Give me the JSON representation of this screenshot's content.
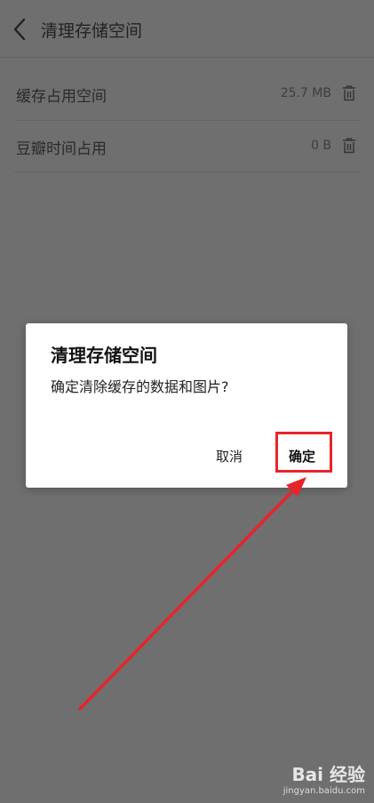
{
  "header": {
    "title": "清理存储空间"
  },
  "storage_rows": [
    {
      "label": "缓存占用空间",
      "value": "25.7 MB"
    },
    {
      "label": "豆瓣时间占用",
      "value": "0 B"
    }
  ],
  "dialog": {
    "title": "清理存储空间",
    "message": "确定清除缓存的数据和图片?",
    "cancel_label": "取消",
    "confirm_label": "确定"
  },
  "watermark": {
    "logo": "Bai 经验",
    "url": "jingyan.baidu.com"
  },
  "colors": {
    "overlay": "#6f6f6f",
    "annotation": "#e8242b",
    "dialog_bg": "#ffffff"
  },
  "icons": {
    "back": "chevron-left-icon",
    "delete": "trash-icon",
    "watermark": "paw-icon"
  }
}
